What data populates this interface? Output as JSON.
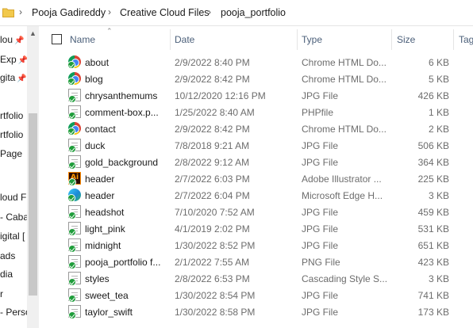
{
  "breadcrumb": {
    "items": [
      "Pooja Gadireddy",
      "Creative Cloud Files",
      "pooja_portfolio"
    ],
    "separator": "›"
  },
  "nav_pane": {
    "items": [
      {
        "label": "lou",
        "pinned": true
      },
      {
        "label": "Exp",
        "pinned": true
      },
      {
        "label": "gita",
        "pinned": true
      },
      {
        "label": "rtfolio",
        "pinned": false
      },
      {
        "label": "rtfolio",
        "pinned": false
      },
      {
        "label": "Page",
        "pinned": false
      },
      {
        "label": "loud F",
        "pinned": false
      },
      {
        "label": "- Caba",
        "pinned": false
      },
      {
        "label": "igital [",
        "pinned": false
      },
      {
        "label": "ads",
        "pinned": false
      },
      {
        "label": "dia",
        "pinned": false
      },
      {
        "label": "r",
        "pinned": false
      },
      {
        "label": "- Perso",
        "pinned": false
      }
    ]
  },
  "columns": {
    "name": "Name",
    "date": "Date",
    "type": "Type",
    "size": "Size",
    "tags": "Tags"
  },
  "files": [
    {
      "name": "about",
      "date": "2/9/2022 8:40 PM",
      "type": "Chrome HTML Do...",
      "size": "6 KB",
      "icon": "chrome-icon"
    },
    {
      "name": "blog",
      "date": "2/9/2022 8:42 PM",
      "type": "Chrome HTML Do...",
      "size": "5 KB",
      "icon": "chrome-icon"
    },
    {
      "name": "chrysanthemums",
      "date": "10/12/2020 12:16 PM",
      "type": "JPG File",
      "size": "426 KB",
      "icon": "image-file-icon"
    },
    {
      "name": "comment-box.p...",
      "date": "1/25/2022 8:40 AM",
      "type": "PHPfile",
      "size": "1 KB",
      "icon": "php-file-icon"
    },
    {
      "name": "contact",
      "date": "2/9/2022 8:42 PM",
      "type": "Chrome HTML Do...",
      "size": "2 KB",
      "icon": "chrome-icon"
    },
    {
      "name": "duck",
      "date": "7/8/2018 9:21 AM",
      "type": "JPG File",
      "size": "506 KB",
      "icon": "image-file-icon"
    },
    {
      "name": "gold_background",
      "date": "2/8/2022 9:12 AM",
      "type": "JPG File",
      "size": "364 KB",
      "icon": "image-file-icon"
    },
    {
      "name": "header",
      "date": "2/7/2022 6:03 PM",
      "type": "Adobe Illustrator ...",
      "size": "225 KB",
      "icon": "illustrator-icon"
    },
    {
      "name": "header",
      "date": "2/7/2022 6:04 PM",
      "type": "Microsoft Edge H...",
      "size": "3 KB",
      "icon": "edge-icon"
    },
    {
      "name": "headshot",
      "date": "7/10/2020 7:52 AM",
      "type": "JPG File",
      "size": "459 KB",
      "icon": "image-file-icon"
    },
    {
      "name": "light_pink",
      "date": "4/1/2019 2:02 PM",
      "type": "JPG File",
      "size": "531 KB",
      "icon": "image-file-icon"
    },
    {
      "name": "midnight",
      "date": "1/30/2022 8:52 PM",
      "type": "JPG File",
      "size": "651 KB",
      "icon": "image-file-icon"
    },
    {
      "name": "pooja_portfolio f...",
      "date": "2/1/2022 7:55 AM",
      "type": "PNG File",
      "size": "423 KB",
      "icon": "image-file-icon"
    },
    {
      "name": "styles",
      "date": "2/8/2022 6:53 PM",
      "type": "Cascading Style S...",
      "size": "3 KB",
      "icon": "css-file-icon"
    },
    {
      "name": "sweet_tea",
      "date": "1/30/2022 8:54 PM",
      "type": "JPG File",
      "size": "741 KB",
      "icon": "image-file-icon"
    },
    {
      "name": "taylor_swift",
      "date": "1/30/2022 8:58 PM",
      "type": "JPG File",
      "size": "173 KB",
      "icon": "image-file-icon"
    }
  ],
  "colors": {
    "header_text": "#4c607a",
    "sync_badge": "#1f9d3b",
    "folder": "#f2c94c"
  }
}
